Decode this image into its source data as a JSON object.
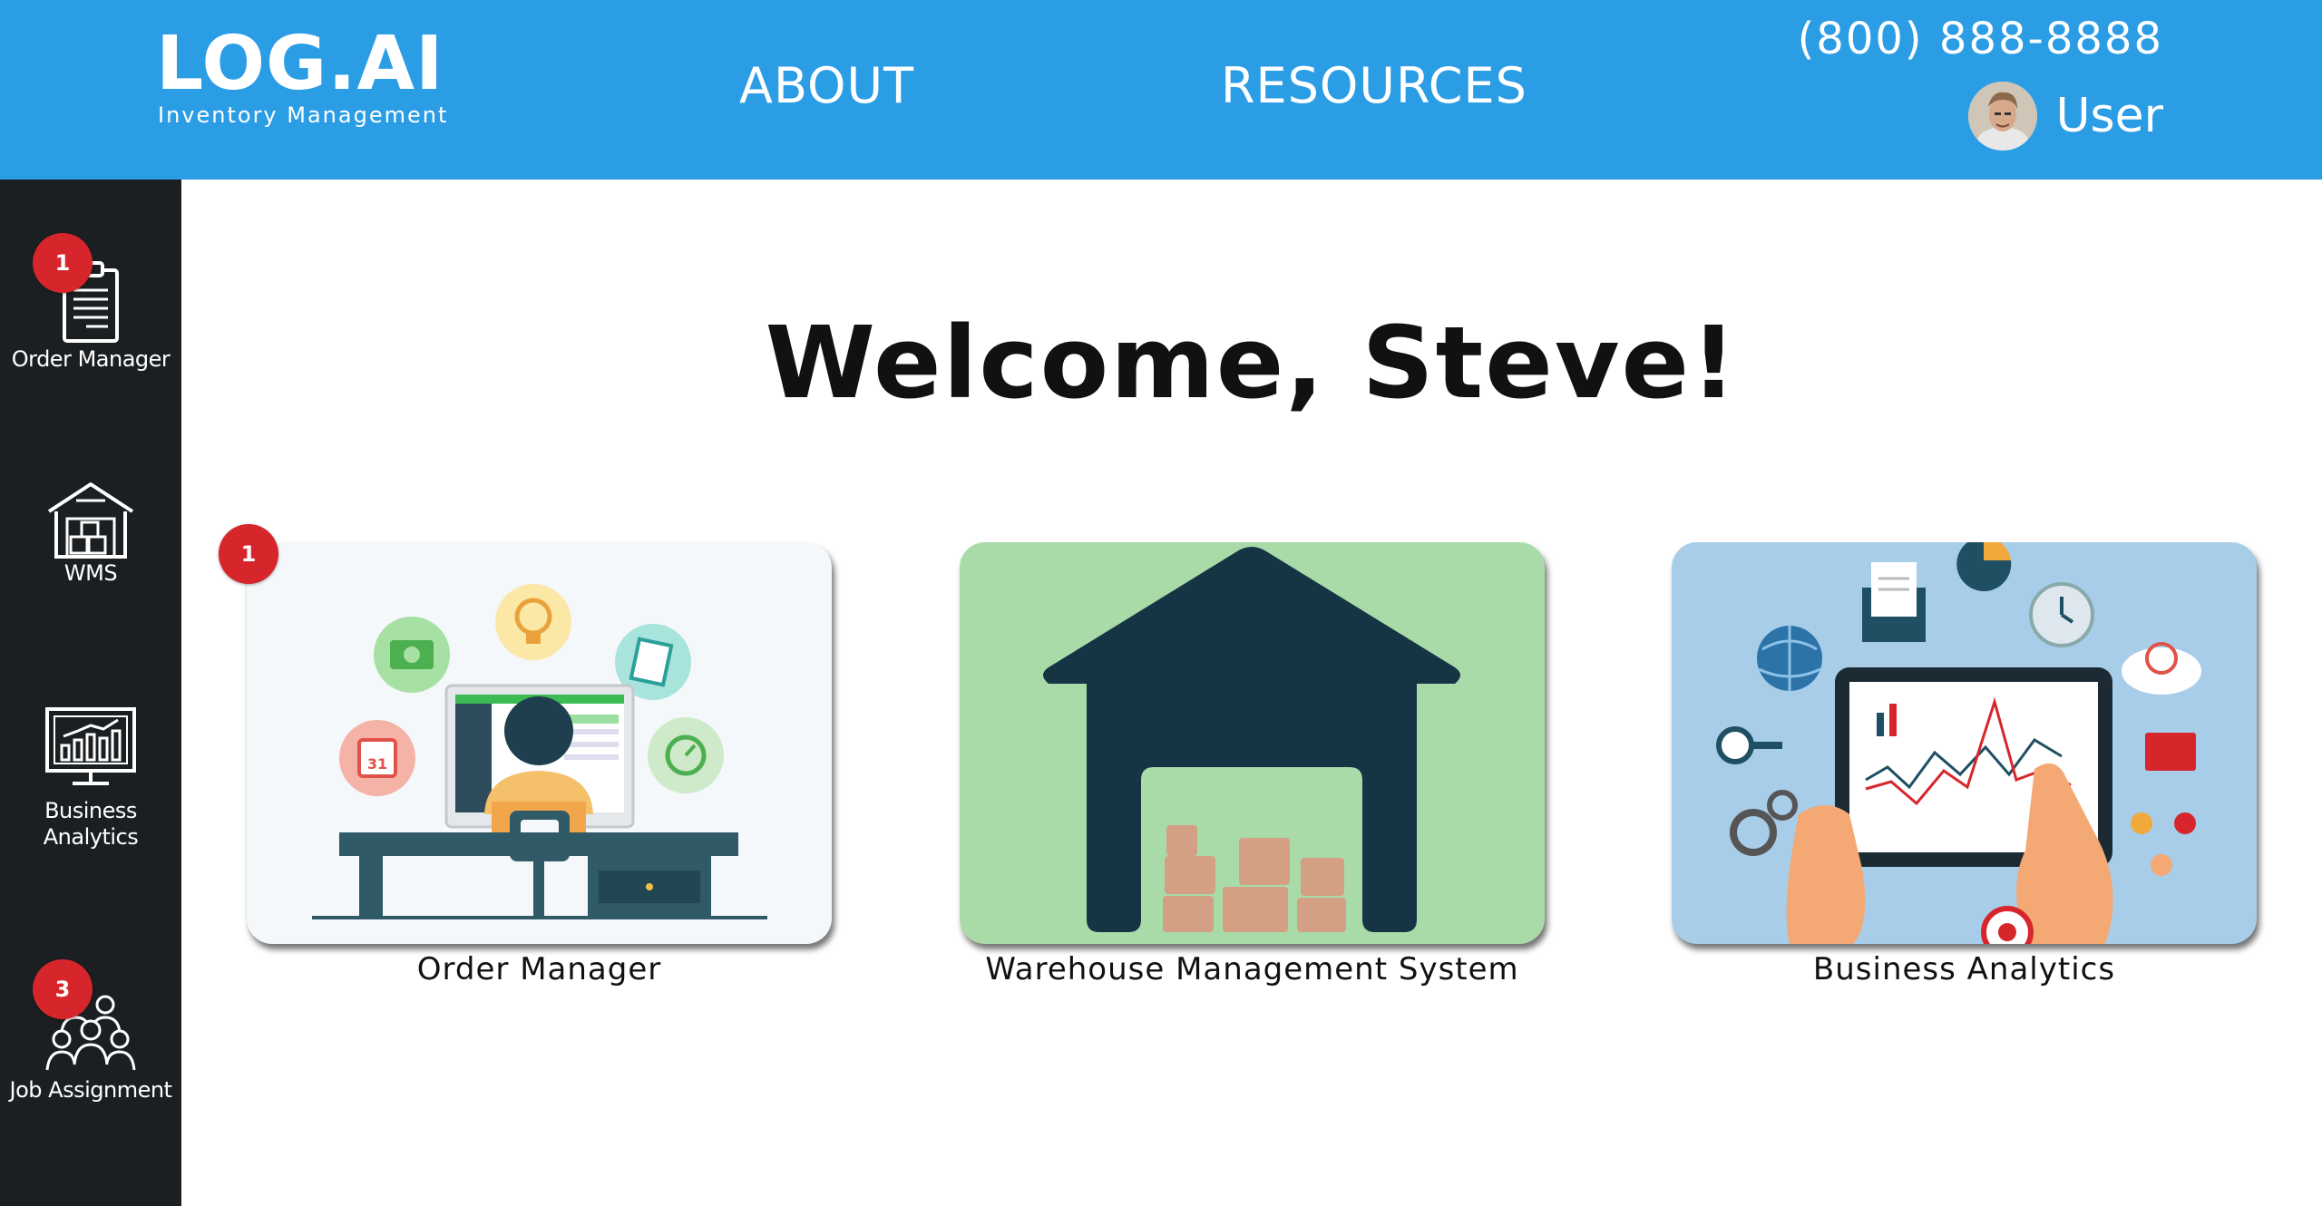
{
  "header": {
    "logo_title": "LOG.AI",
    "logo_subtitle": "Inventory Management",
    "nav": [
      {
        "label": "ABOUT"
      },
      {
        "label": "RESOURCES"
      }
    ],
    "phone": "(800) 888-8888",
    "user_label": "User",
    "avatar_icon": "user-avatar-photo"
  },
  "sidebar": {
    "items": [
      {
        "label": "Order Manager",
        "icon": "clipboard-icon",
        "badge": "1"
      },
      {
        "label": "WMS",
        "icon": "warehouse-icon"
      },
      {
        "label": "Business Analytics",
        "icon": "analytics-monitor-icon"
      },
      {
        "label": "Job Assignment",
        "icon": "team-icon",
        "badge": "3"
      }
    ]
  },
  "main": {
    "welcome": "Welcome, Steve!",
    "cards": [
      {
        "label": "Order Manager",
        "badge": "1",
        "image": "person-at-computer-illustration"
      },
      {
        "label": "Warehouse Management System",
        "image": "warehouse-illustration"
      },
      {
        "label": "Business Analytics",
        "image": "tablet-analytics-illustration"
      }
    ]
  },
  "colors": {
    "header_bg": "#2b9de5",
    "sidebar_bg": "#1c1f22",
    "badge_red": "#d7262b",
    "card_wms_bg": "#a9dba9",
    "card_ba_bg": "#a7cde9"
  }
}
